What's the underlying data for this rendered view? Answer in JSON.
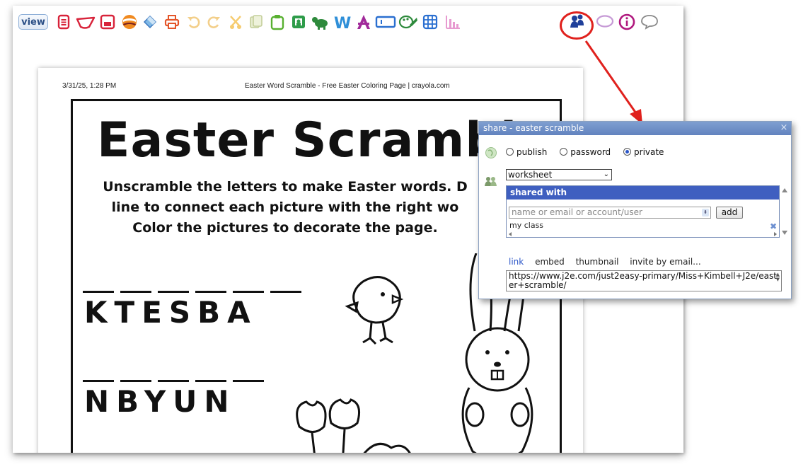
{
  "toolbar": {
    "view_label": "view",
    "icons": [
      "file-menu-icon",
      "open-folder-icon",
      "save-icon",
      "mix-icon",
      "paint-icon",
      "print-icon",
      "undo-icon",
      "redo-icon",
      "cut-icon",
      "copy-icon",
      "paste-icon",
      "picture-icon",
      "clipart-icon",
      "word-icon",
      "jit-icon",
      "textbox-icon",
      "paint-palette-icon",
      "table-icon",
      "chart-icon",
      "share-icon",
      "speech-bubble-icon",
      "info-icon",
      "comment-icon"
    ]
  },
  "sheet": {
    "date": "3/31/25, 1:28 PM",
    "page_title": "Easter Word Scramble - Free Easter Coloring Page | crayola.com",
    "heading": "Easter Scramble",
    "instructions": [
      "Unscramble the letters to make Easter words. D",
      "line to connect each picture with the right wo",
      "Color the pictures to decorate the page."
    ],
    "words": [
      "KTESBA",
      "NBYUN"
    ]
  },
  "share": {
    "title": "share - easter scramble",
    "close": "×",
    "options": [
      "publish",
      "password",
      "private"
    ],
    "selected_option": "private",
    "type_value": "worksheet",
    "shared_with_heading": "shared with",
    "name_placeholder": "name or email or account/user",
    "add_label": "add",
    "shared_entry": "my class",
    "tabs": [
      "link",
      "embed",
      "thumbnail",
      "invite by email..."
    ],
    "active_tab": "link",
    "url": "https://www.j2e.com/just2easy-primary/Miss+Kimbell+J2e/easter+scramble/"
  },
  "colors": {
    "annotation_red": "#e0211d",
    "dialog_header": "#6283bf",
    "shared_header": "#3f5fc0"
  }
}
